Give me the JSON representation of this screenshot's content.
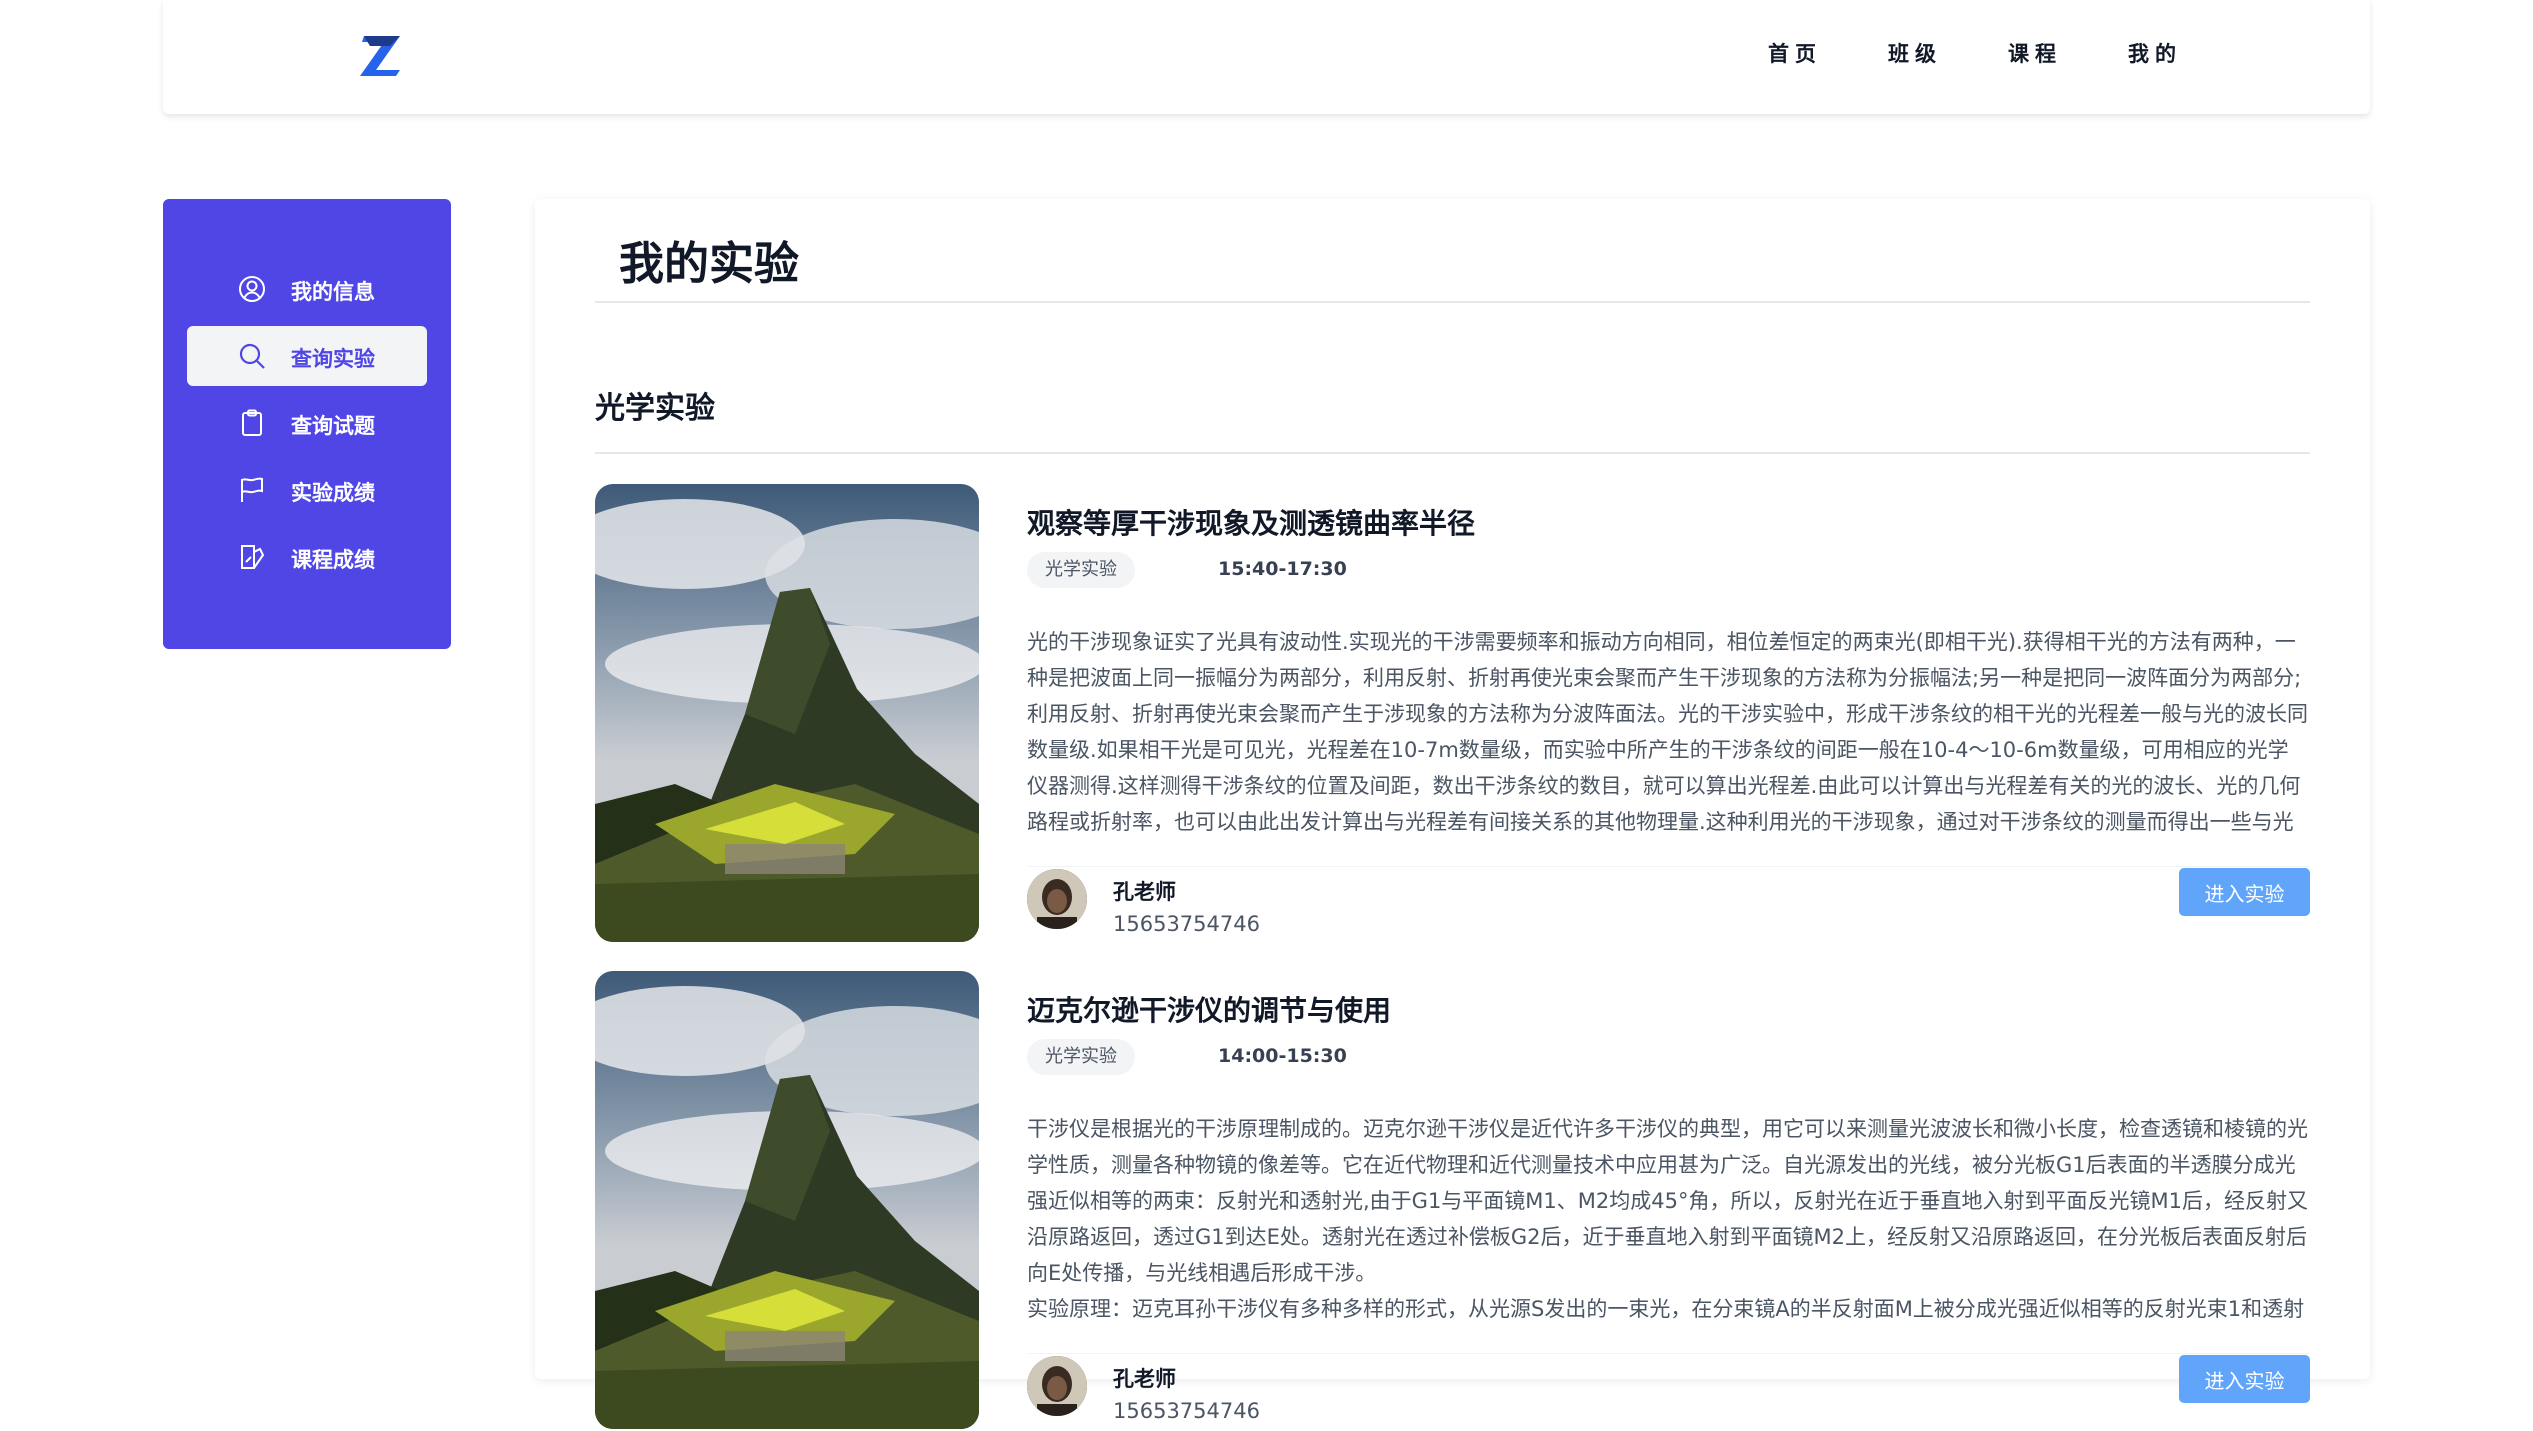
{
  "nav": {
    "logo_icon": "z-logo-icon",
    "items": [
      {
        "label": "首页"
      },
      {
        "label": "班级"
      },
      {
        "label": "课程"
      },
      {
        "label": "我的"
      }
    ]
  },
  "sidebar": {
    "accent": "#4f46e5",
    "items": [
      {
        "label": "我的信息",
        "icon": "user-circle-icon"
      },
      {
        "label": "查询实验",
        "icon": "search-icon",
        "active": true
      },
      {
        "label": "查询试题",
        "icon": "clipboard-icon"
      },
      {
        "label": "实验成绩",
        "icon": "flag-icon"
      },
      {
        "label": "课程成绩",
        "icon": "book-pen-icon"
      }
    ]
  },
  "main": {
    "title": "我的实验",
    "section_title": "光学实验",
    "experiments": [
      {
        "title": "观察等厚干涉现象及测透镜曲率半径",
        "tag": "光学实验",
        "time": "15:40-17:30",
        "description": "光的干涉现象证实了光具有波动性.实现光的干涉需要频率和振动方向相同，相位差恒定的两束光(即相干光).获得相干光的方法有两种，一种是把波面上同一振幅分为两部分，利用反射、折射再使光束会聚而产生干涉现象的方法称为分振幅法;另一种是把同一波阵面分为两部分;利用反射、折射再使光束会聚而产生于涉现象的方法称为分波阵面法。光的干涉实验中，形成干涉条纹的相干光的光程差一般与光的波长同数量级.如果相干光是可见光，光程差在10-7m数量级，而实验中所产生的干涉条纹的间距一般在10-4～10-6m数量级，可用相应的光学仪器测得.这样测得干涉条纹的位置及间距，数出干涉条纹的数目，就可以算出光程差.由此可以计算出与光程差有关的光的波长、光的几何路程或折射率，也可以由此出发计算出与光程差有间接关系的其他物理量.这种利用光的干涉现象，通过对干涉条纹的测量而得出一些与光的",
        "teacher_name": "孔老师",
        "teacher_phone": "15653754746",
        "button_label": "进入实验"
      },
      {
        "title": "迈克尔逊干涉仪的调节与使用",
        "tag": "光学实验",
        "time": "14:00-15:30",
        "description": "干涉仪是根据光的干涉原理制成的。迈克尔逊干涉仪是近代许多干涉仪的典型，用它可以来测量光波波长和微小长度，检查透镜和棱镜的光学性质，测量各种物镜的像差等。它在近代物理和近代测量技术中应用甚为广泛。自光源发出的光线，被分光板G1后表面的半透膜分成光强近似相等的两束：反射光和透射光,由于G1与平面镜M1、M2均成45°角，所以，反射光在近于垂直地入射到平面反光镜M1后，经反射又沿原路返回，透过G1到达E处。透射光在透过补偿板G2后，近于垂直地入射到平面镜M2上，经反射又沿原路返回，在分光板后表面反射后向E处传播，与光线相遇后形成干涉。\n实验原理：迈克耳孙干涉仪有多种多样的形式，从光源S发出的一束光，在分束镜A的半反射面M上被分成光强近似相等的反射光束1和透射",
        "teacher_name": "孔老师",
        "teacher_phone": "15653754746",
        "button_label": "进入实验"
      }
    ]
  }
}
